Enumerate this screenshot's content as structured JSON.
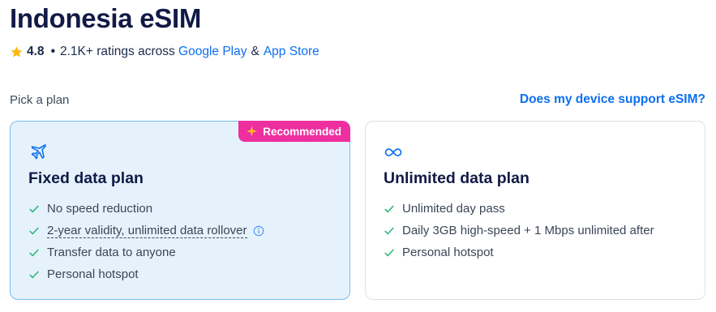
{
  "header": {
    "title": "Indonesia eSIM",
    "rating": "4.8",
    "ratings_text": "2.1K+ ratings across",
    "store_google": "Google Play",
    "amp": "&",
    "store_apple": "App Store"
  },
  "section": {
    "pick_label": "Pick a plan",
    "help_link": "Does my device support eSIM?"
  },
  "plans": [
    {
      "badge": "Recommended",
      "icon": "airplane-icon",
      "title": "Fixed data plan",
      "selected": true,
      "features": [
        "No speed reduction",
        "2-year validity, unlimited data rollover",
        "Transfer data to anyone",
        "Personal hotspot"
      ]
    },
    {
      "icon": "infinity-icon",
      "title": "Unlimited data plan",
      "selected": false,
      "features": [
        "Unlimited day pass",
        "Daily 3GB high-speed + 1 Mbps unlimited after",
        "Personal hotspot"
      ]
    }
  ],
  "colors": {
    "brand_blue": "#0d6ff0",
    "badge_pink": "#ee2f9f",
    "check_green": "#2bb673",
    "selected_bg": "#e5f2fc",
    "selected_border": "#76bdee"
  }
}
